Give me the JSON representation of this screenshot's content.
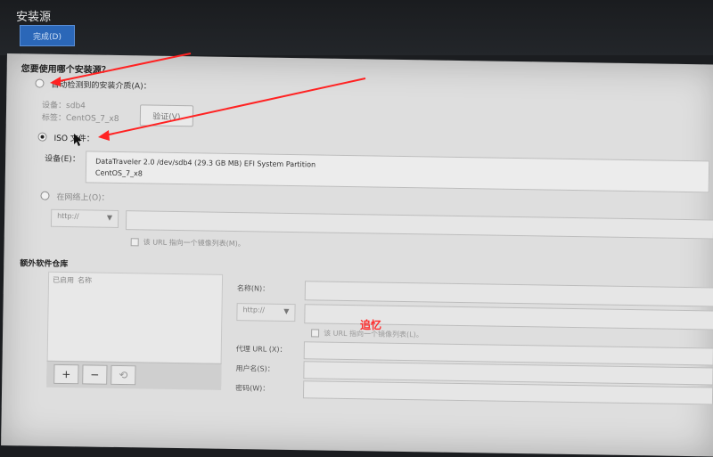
{
  "header": {
    "title": "安装源",
    "done_button": "完成(D)"
  },
  "prompt": {
    "question": "您要使用哪个安装源？"
  },
  "source_auto": {
    "label": "自动检测到的安装介质(A)：",
    "device": "设备：sdb4",
    "label_text": "标签：CentOS_7_x8",
    "verify_button": "验证(V)"
  },
  "source_iso": {
    "label": "ISO 文件：",
    "device_label": "设备(E)：",
    "device_value_line1": "DataTraveler 2.0 /dev/sdb4 (29.3 GB MB) EFI System Partition",
    "device_value_line2": "CentOS_7_x8"
  },
  "source_network": {
    "label": "在网络上(O)：",
    "protocol": "http://",
    "mirror_checkbox": "该 URL 指向一个镜像列表(M)。"
  },
  "extra_repos": {
    "heading": "额外软件仓库",
    "columns": [
      "已启用",
      "名称"
    ],
    "toolbar": {
      "add": "+",
      "remove": "−",
      "reset": "⟲"
    },
    "name_label": "名称(N)：",
    "protocol": "http://",
    "mirror_checkbox": "该 URL 指向一个镜像列表(L)。",
    "proxy_label": "代理 URL (X)：",
    "username_label": "用户名(S)：",
    "password_label": "密码(W)："
  },
  "annotation": {
    "text": "追忆",
    "color": "#ff2a2a"
  }
}
